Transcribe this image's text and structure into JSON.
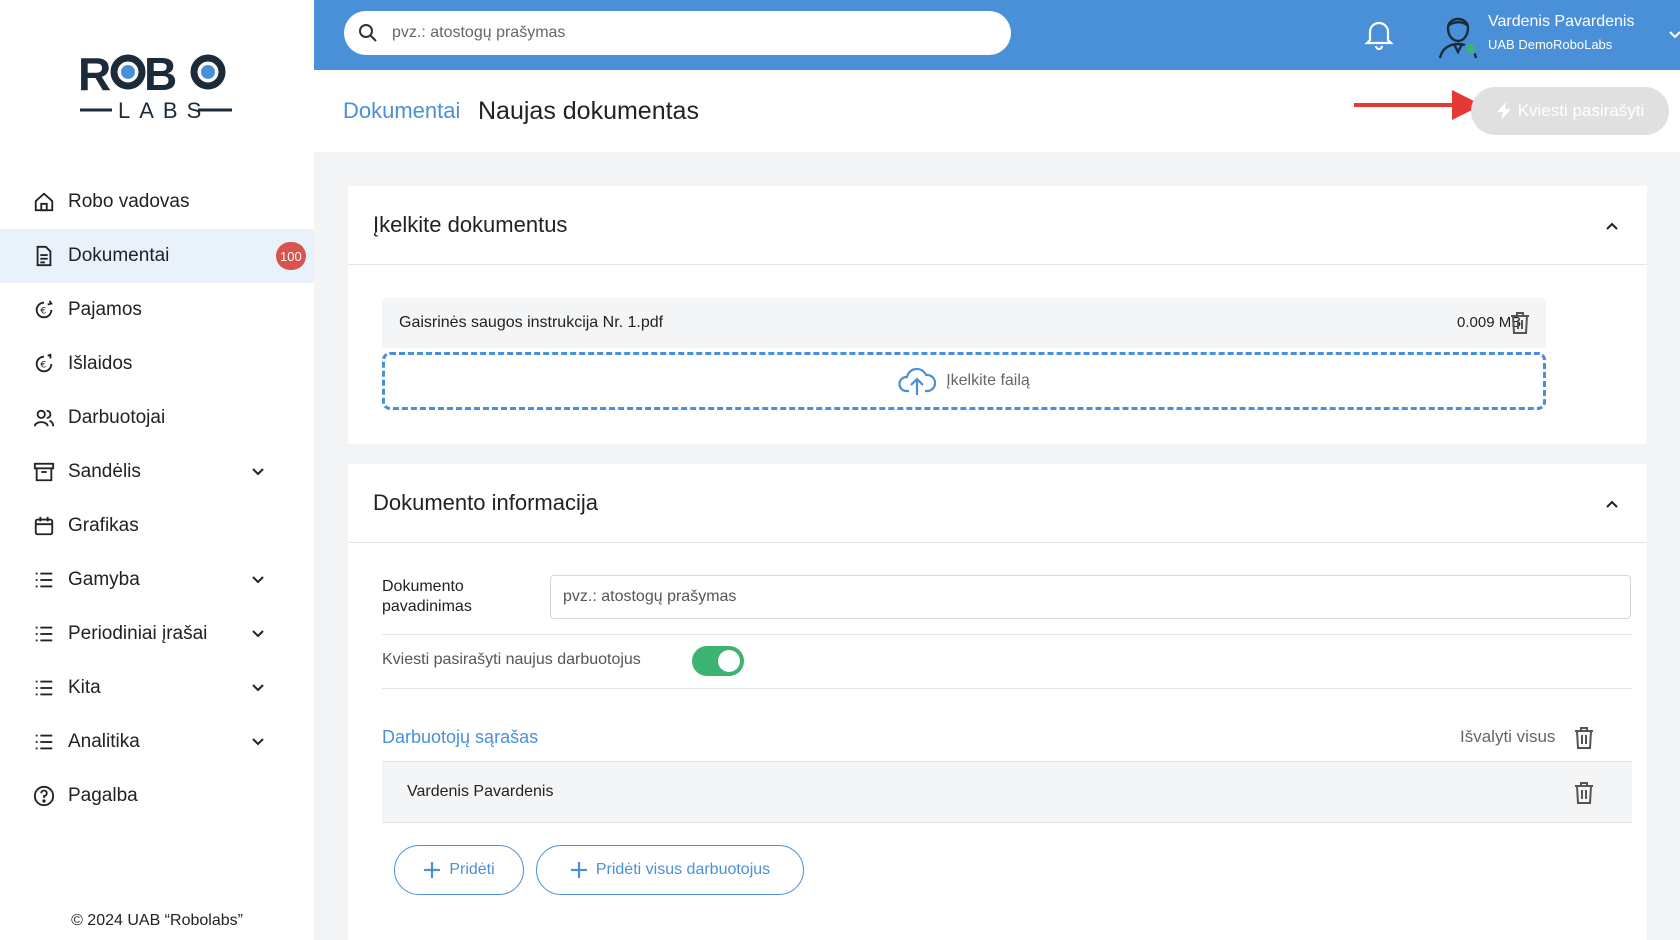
{
  "brand": {
    "logo_top": "ROBO",
    "logo_bottom": "LABS"
  },
  "sidebar": {
    "items": [
      {
        "label": "Robo vadovas",
        "icon": "home-icon"
      },
      {
        "label": "Dokumentai",
        "icon": "document-icon",
        "badge": "100",
        "active": true
      },
      {
        "label": "Pajamos",
        "icon": "income-icon"
      },
      {
        "label": "Išlaidos",
        "icon": "expenses-icon"
      },
      {
        "label": "Darbuotojai",
        "icon": "users-icon"
      },
      {
        "label": "Sandėlis",
        "icon": "archive-icon",
        "expandable": true
      },
      {
        "label": "Grafikas",
        "icon": "calendar-icon"
      },
      {
        "label": "Gamyba",
        "icon": "list-icon",
        "expandable": true
      },
      {
        "label": "Periodiniai įrašai",
        "icon": "list-icon",
        "expandable": true
      },
      {
        "label": "Kita",
        "icon": "list-icon",
        "expandable": true
      },
      {
        "label": "Analitika",
        "icon": "list-icon",
        "expandable": true
      },
      {
        "label": "Pagalba",
        "icon": "help-icon"
      }
    ],
    "copyright": "© 2024 UAB “Robolabs”"
  },
  "topbar": {
    "search_placeholder": "pvz.: atostogų prašymas",
    "user_name": "Vardenis Pavardenis",
    "user_org": "UAB DemoRoboLabs"
  },
  "header": {
    "breadcrumb": "Dokumentai",
    "title": "Naujas dokumentas",
    "sign_button": "Kviesti pasirašyti"
  },
  "upload": {
    "title": "Įkelkite dokumentus",
    "file_name": "Gaisrinės saugos instrukcija Nr. 1.pdf",
    "file_size": "0.009 MB",
    "dropzone_label": "Įkelkite failą"
  },
  "info": {
    "title": "Dokumento informacija",
    "name_label": "Dokumento pavadinimas",
    "name_placeholder": "pvz.: atostogų prašymas",
    "toggle_label": "Kviesti pasirašyti naujus darbuotojus",
    "toggle_on": true,
    "list_title": "Darbuotojų sąrašas",
    "clear_all": "Išvalyti visus",
    "employees": [
      "Vardenis Pavardenis"
    ],
    "add_button": "Pridėti",
    "add_all_button": "Pridėti visus darbuotojus"
  },
  "colors": {
    "accent": "#4a90d9",
    "badge": "#d9534f",
    "toggle": "#3cb371",
    "arrow": "#e53935"
  }
}
